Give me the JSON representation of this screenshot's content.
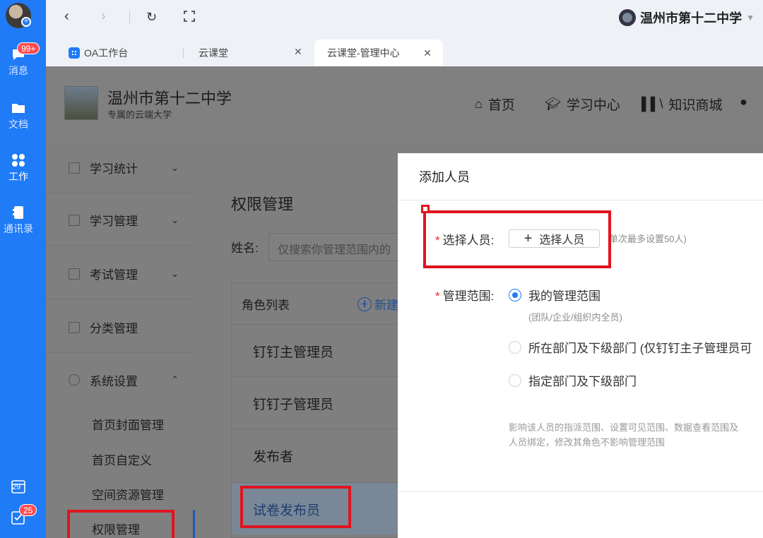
{
  "rail": {
    "messages_label": "消息",
    "messages_badge": "99+",
    "docs_label": "文档",
    "work_label": "工作",
    "contacts_label": "通讯录",
    "calendar_day": "29",
    "todo_badge": "25"
  },
  "topbar": {
    "org_name": "温州市第十二中学"
  },
  "tabs": [
    {
      "label": "OA工作台"
    },
    {
      "label": "云课堂"
    },
    {
      "label": "云课堂-管理中心"
    }
  ],
  "site": {
    "school_name": "温州市第十二中学",
    "school_sub": "专属的云端大学",
    "nav": [
      {
        "label": "首页",
        "icon": "home-icon"
      },
      {
        "label": "学习中心",
        "icon": "graduation-cap-icon"
      },
      {
        "label": "知识商城",
        "icon": "books-icon"
      }
    ]
  },
  "sidebar": {
    "items": [
      {
        "label": "学习统计",
        "icon": "chart-icon",
        "arrow": "⌄"
      },
      {
        "label": "学习管理",
        "icon": "book-icon",
        "arrow": "⌄"
      },
      {
        "label": "考试管理",
        "icon": "exam-icon",
        "arrow": "⌄"
      },
      {
        "label": "分类管理",
        "icon": "category-icon",
        "arrow": ""
      },
      {
        "label": "系统设置",
        "icon": "settings-icon",
        "arrow": "⌃"
      }
    ],
    "sub_items": [
      {
        "label": "首页封面管理"
      },
      {
        "label": "首页自定义"
      },
      {
        "label": "空间资源管理"
      },
      {
        "label": "权限管理"
      }
    ]
  },
  "main": {
    "title": "权限管理",
    "filter_label": "姓名:",
    "filter_placeholder": "仅搜索你管理范围内的",
    "role_list_title": "角色列表",
    "new_label": "新建",
    "roles": [
      {
        "label": "钉钉主管理员"
      },
      {
        "label": "钉钉子管理员"
      },
      {
        "label": "发布者"
      },
      {
        "label": "试卷发布员"
      }
    ]
  },
  "modal": {
    "title": "添加人员",
    "required_mark": "*",
    "select_label": "选择人员:",
    "select_button": "选择人员",
    "select_hint": "单次最多设置50人)",
    "scope_label": "管理范围:",
    "options": [
      {
        "label": "我的管理范围",
        "selected": true
      },
      {
        "label": "所在部门及下级部门 (仅钉钉主子管理员可",
        "selected": false
      },
      {
        "label": "指定部门及下级部门",
        "selected": false
      }
    ],
    "option1_sub": "(团队/企业/组织内全员)",
    "desc_line1": "影响该人员的指派范围、设置可见范围、数据查看范围及",
    "desc_line2": "人员绑定，修改其角色不影响管理范围"
  },
  "colors": {
    "rail_blue": "#1f7bf6",
    "annotation_red": "#e0141e",
    "required_red": "#f5222d"
  }
}
